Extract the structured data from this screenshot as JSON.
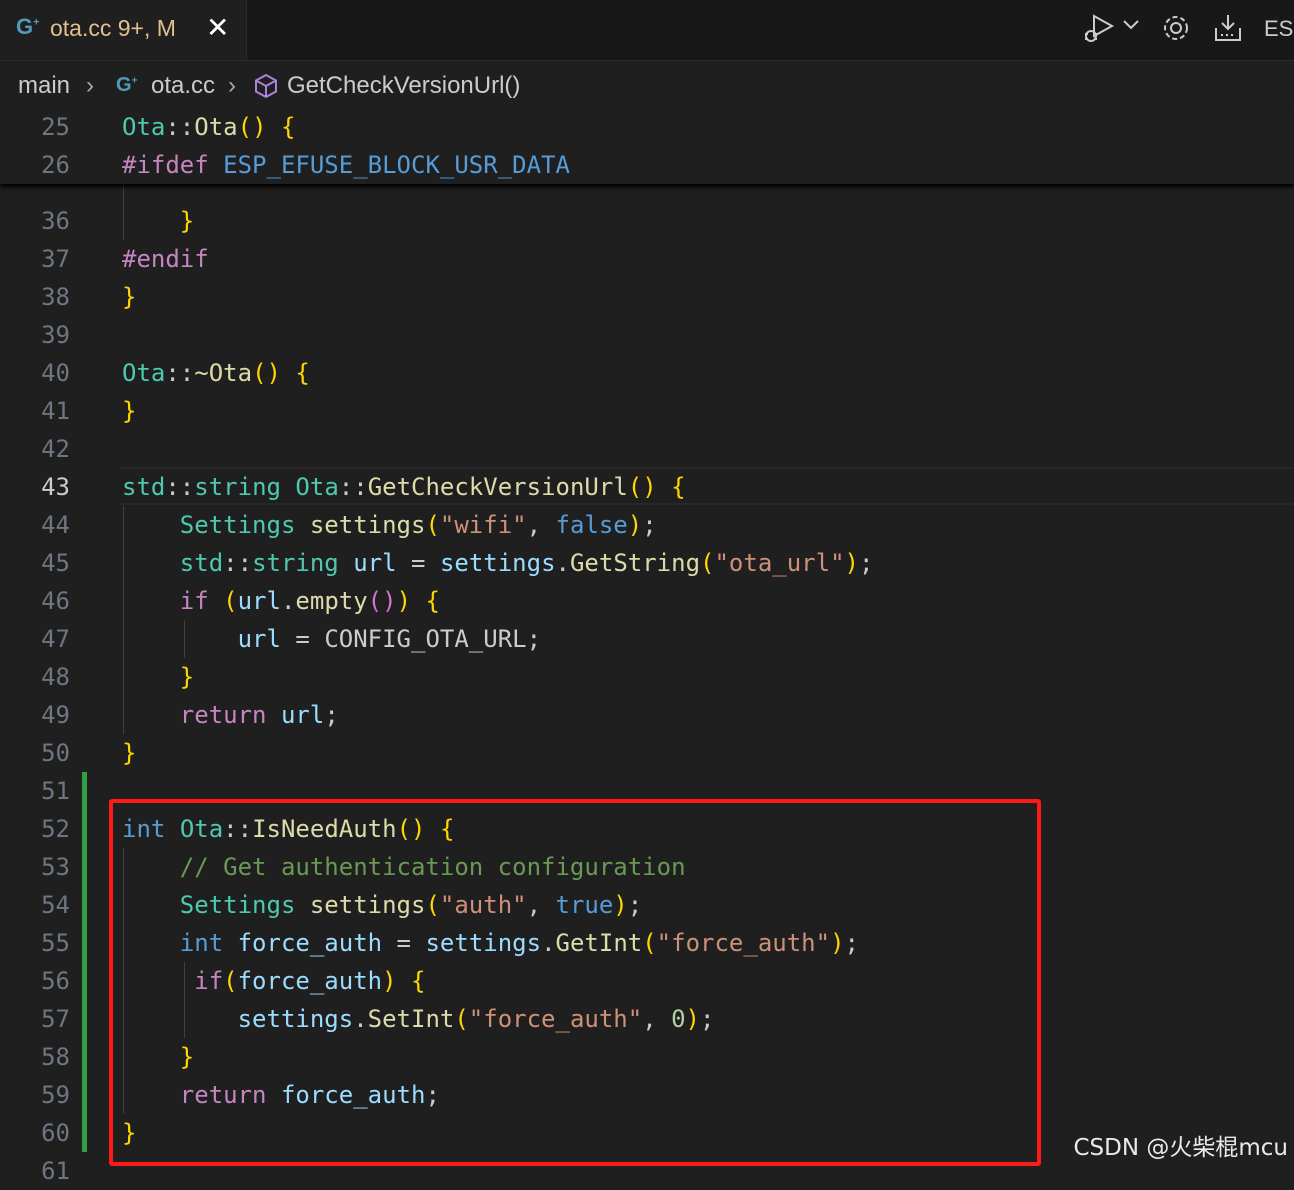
{
  "tab": {
    "icon": "cpp-file-icon",
    "filename": "ota.cc",
    "status": "9+, M"
  },
  "toolbar": {
    "items": [
      "run-debug-icon",
      "chevron-down-icon",
      "gear-icon",
      "download-flash-icon"
    ],
    "truncated_label": "ESP"
  },
  "breadcrumb": {
    "folder": "main",
    "file": "ota.cc",
    "symbol": "GetCheckVersionUrl()"
  },
  "sticky_lines": [
    {
      "num": "25",
      "text": "Ota::Ota() {"
    },
    {
      "num": "26",
      "text": "#ifdef ESP_EFUSE_BLOCK_USR_DATA"
    }
  ],
  "lines": [
    {
      "num": "36",
      "text": "    }"
    },
    {
      "num": "37",
      "text": "#endif"
    },
    {
      "num": "38",
      "text": "}"
    },
    {
      "num": "39",
      "text": ""
    },
    {
      "num": "40",
      "text": "Ota::~Ota() {"
    },
    {
      "num": "41",
      "text": "}"
    },
    {
      "num": "42",
      "text": ""
    },
    {
      "num": "43",
      "text": "std::string Ota::GetCheckVersionUrl() {"
    },
    {
      "num": "44",
      "text": "    Settings settings(\"wifi\", false);"
    },
    {
      "num": "45",
      "text": "    std::string url = settings.GetString(\"ota_url\");"
    },
    {
      "num": "46",
      "text": "    if (url.empty()) {"
    },
    {
      "num": "47",
      "text": "        url = CONFIG_OTA_URL;"
    },
    {
      "num": "48",
      "text": "    }"
    },
    {
      "num": "49",
      "text": "    return url;"
    },
    {
      "num": "50",
      "text": "}"
    },
    {
      "num": "51",
      "text": ""
    },
    {
      "num": "52",
      "text": "int Ota::IsNeedAuth() {"
    },
    {
      "num": "53",
      "text": "    // Get authentication configuration"
    },
    {
      "num": "54",
      "text": "    Settings settings(\"auth\", true);"
    },
    {
      "num": "55",
      "text": "    int force_auth = settings.GetInt(\"force_auth\");"
    },
    {
      "num": "56",
      "text": "     if(force_auth) {"
    },
    {
      "num": "57",
      "text": "        settings.SetInt(\"force_auth\", 0);"
    },
    {
      "num": "58",
      "text": "    }"
    },
    {
      "num": "59",
      "text": "    return force_auth;"
    },
    {
      "num": "60",
      "text": "}"
    },
    {
      "num": "61",
      "text": ""
    }
  ],
  "active_line": "43",
  "watermark": "CSDN @火柴棍mcu",
  "colors": {
    "git_added": "#2ea043",
    "highlight_box": "#ff1a1a",
    "background": "#1f1f1f"
  }
}
